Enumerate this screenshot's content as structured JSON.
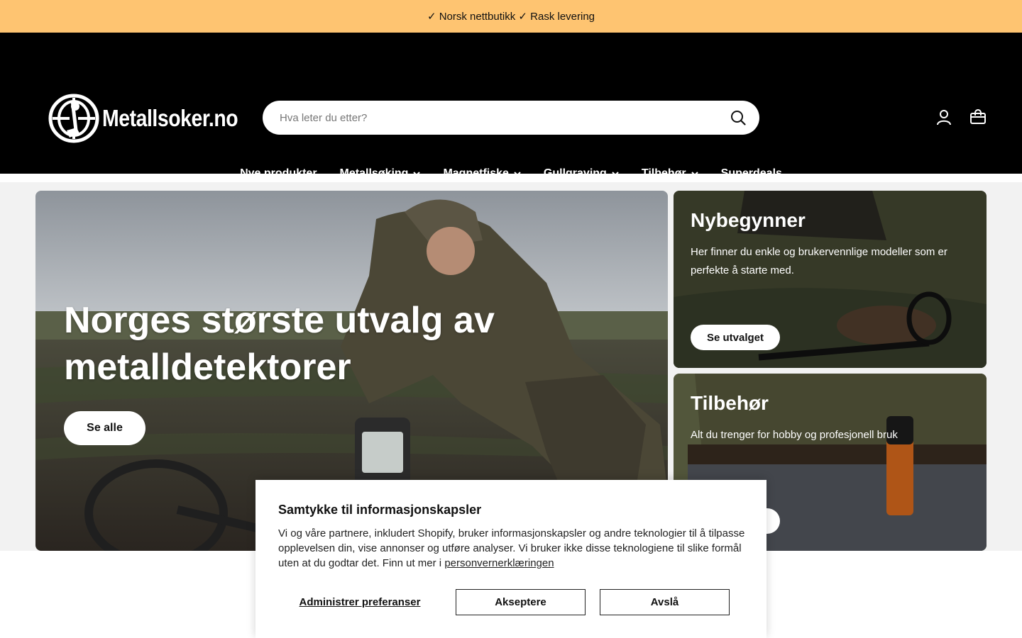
{
  "announcement": "✓ Norsk nettbutikk ✓ Rask levering",
  "header": {
    "logo_text": "Metallsoker.no",
    "search_placeholder": "Hva leter du etter?"
  },
  "nav": {
    "items": [
      {
        "label": "Nye produkter"
      },
      {
        "label": "Metallsøking"
      },
      {
        "label": "Magnetfiske"
      },
      {
        "label": "Gullgraving"
      },
      {
        "label": "Tilbehør"
      },
      {
        "label": "Superdeals"
      }
    ]
  },
  "hero": {
    "title": "Norges største utvalg av metalldetektorer",
    "button": "Se alle"
  },
  "side_cards": [
    {
      "title": "Nybegynner",
      "text": "Her finner du enkle og brukervennlige modeller som er perfekte å starte med.",
      "button": "Se utvalget"
    },
    {
      "title": "Tilbehør",
      "text": "Alt du trenger for hobby og profesjonell bruk"
    }
  ],
  "cookie": {
    "title": "Samtykke til informasjonskapsler",
    "body": "Vi og våre partnere, inkludert Shopify, bruker informasjonskapsler og andre teknologier til å tilpasse opplevelsen din, vise annonser og utføre analyser. Vi bruker ikke disse teknologiene til slike formål uten at du godtar det. Finn ut mer i ",
    "link": "personvernerklæringen",
    "manage": "Administrer preferanser",
    "accept": "Akseptere",
    "decline": "Avslå"
  },
  "colors": {
    "announcement_bg": "#fec471",
    "header_bg": "#000000"
  }
}
